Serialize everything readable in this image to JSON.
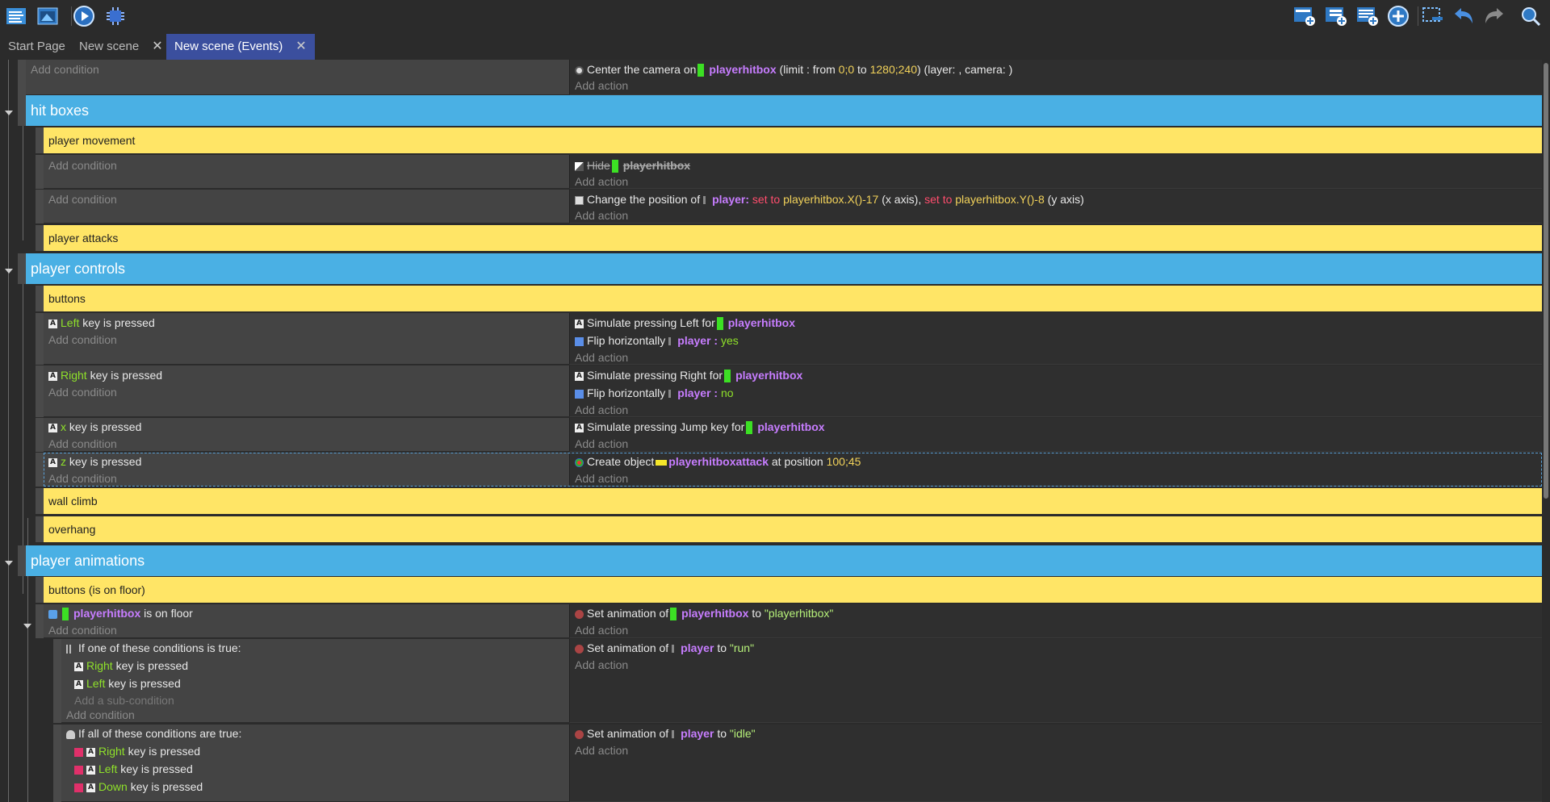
{
  "toolbar": {
    "left_icons": [
      "events-list-icon",
      "scene-window-icon",
      "preview-play-icon",
      "debugger-icon"
    ],
    "right_icons": [
      "add-event-icon",
      "add-subevent-icon",
      "add-comment-icon",
      "add-more-icon",
      "select-delete-icon",
      "undo-icon",
      "redo-icon",
      "search-icon"
    ]
  },
  "tabs": [
    {
      "label": "Start Page",
      "closable": false,
      "active": false
    },
    {
      "label": "New scene",
      "closable": true,
      "active": false
    },
    {
      "label": "New scene (Events)",
      "closable": true,
      "active": true
    }
  ],
  "common": {
    "add_condition": "Add condition",
    "add_action": "Add action",
    "add_subcondition": "Add a sub-condition"
  },
  "top_event": {
    "action": {
      "text": "Center the camera on",
      "object": "playerhitbox",
      "limit_prefix": "(limit : from",
      "from": "0;0",
      "to_word": "to",
      "to": "1280;240",
      "suffix": ") (layer: , camera: )"
    }
  },
  "groups": {
    "hit_boxes": "hit boxes",
    "player_controls": "player controls",
    "player_animations": "player animations"
  },
  "comments": {
    "player_movement": "player movement",
    "player_attacks": "player attacks",
    "buttons": "buttons",
    "wall_climb": "wall climb",
    "overhang": "overhang",
    "buttons_on_floor": "buttons (is on floor)"
  },
  "hide_event": {
    "action": "Hide",
    "object": "playerhitbox"
  },
  "position_event": {
    "text": "Change the position of",
    "object": "player:",
    "set_to": "set to",
    "x_expr": "playerhitbox.X()-17",
    "x_axis": "(x axis),",
    "set_to2": "set to",
    "y_expr": "playerhitbox.Y()-8",
    "y_axis": "(y axis)"
  },
  "left_event": {
    "key": "Left",
    "cond_suffix": "key is pressed",
    "a1": "Simulate pressing Left for",
    "a1_obj": "playerhitbox",
    "a2": "Flip horizontally",
    "a2_obj": "player :",
    "a2_val": "yes"
  },
  "right_event": {
    "key": "Right",
    "cond_suffix": "key is pressed",
    "a1": "Simulate pressing Right for",
    "a1_obj": "playerhitbox",
    "a2": "Flip horizontally",
    "a2_obj": "player :",
    "a2_val": "no"
  },
  "x_event": {
    "key": "x",
    "cond_suffix": "key is pressed",
    "a1": "Simulate pressing Jump key for",
    "a1_obj": "playerhitbox"
  },
  "z_event": {
    "key": "z",
    "cond_suffix": "key is pressed",
    "a1": "Create object",
    "a1_obj": "playerhitboxattack",
    "a1_mid": "at position",
    "a1_val": "100;45"
  },
  "floor_event": {
    "object": "playerhitbox",
    "cond_suffix": "is on floor",
    "a1": "Set animation of",
    "a1_obj": "playerhitbox",
    "a1_to": "to",
    "a1_val": "\"playerhitbox\""
  },
  "run_event": {
    "or_text": "If one of these conditions is true:",
    "k1": "Right",
    "k2": "Left",
    "cond_suffix": "key is pressed",
    "a1": "Set animation of",
    "a1_obj": "player",
    "a1_to": "to",
    "a1_val": "\"run\""
  },
  "idle_event": {
    "and_text": "If all of these conditions are true:",
    "k1": "Right",
    "k2": "Left",
    "k3": "Down",
    "cond_suffix": "key is pressed",
    "a1": "Set animation of",
    "a1_obj": "player",
    "a1_to": "to",
    "a1_val": "\"idle\""
  }
}
